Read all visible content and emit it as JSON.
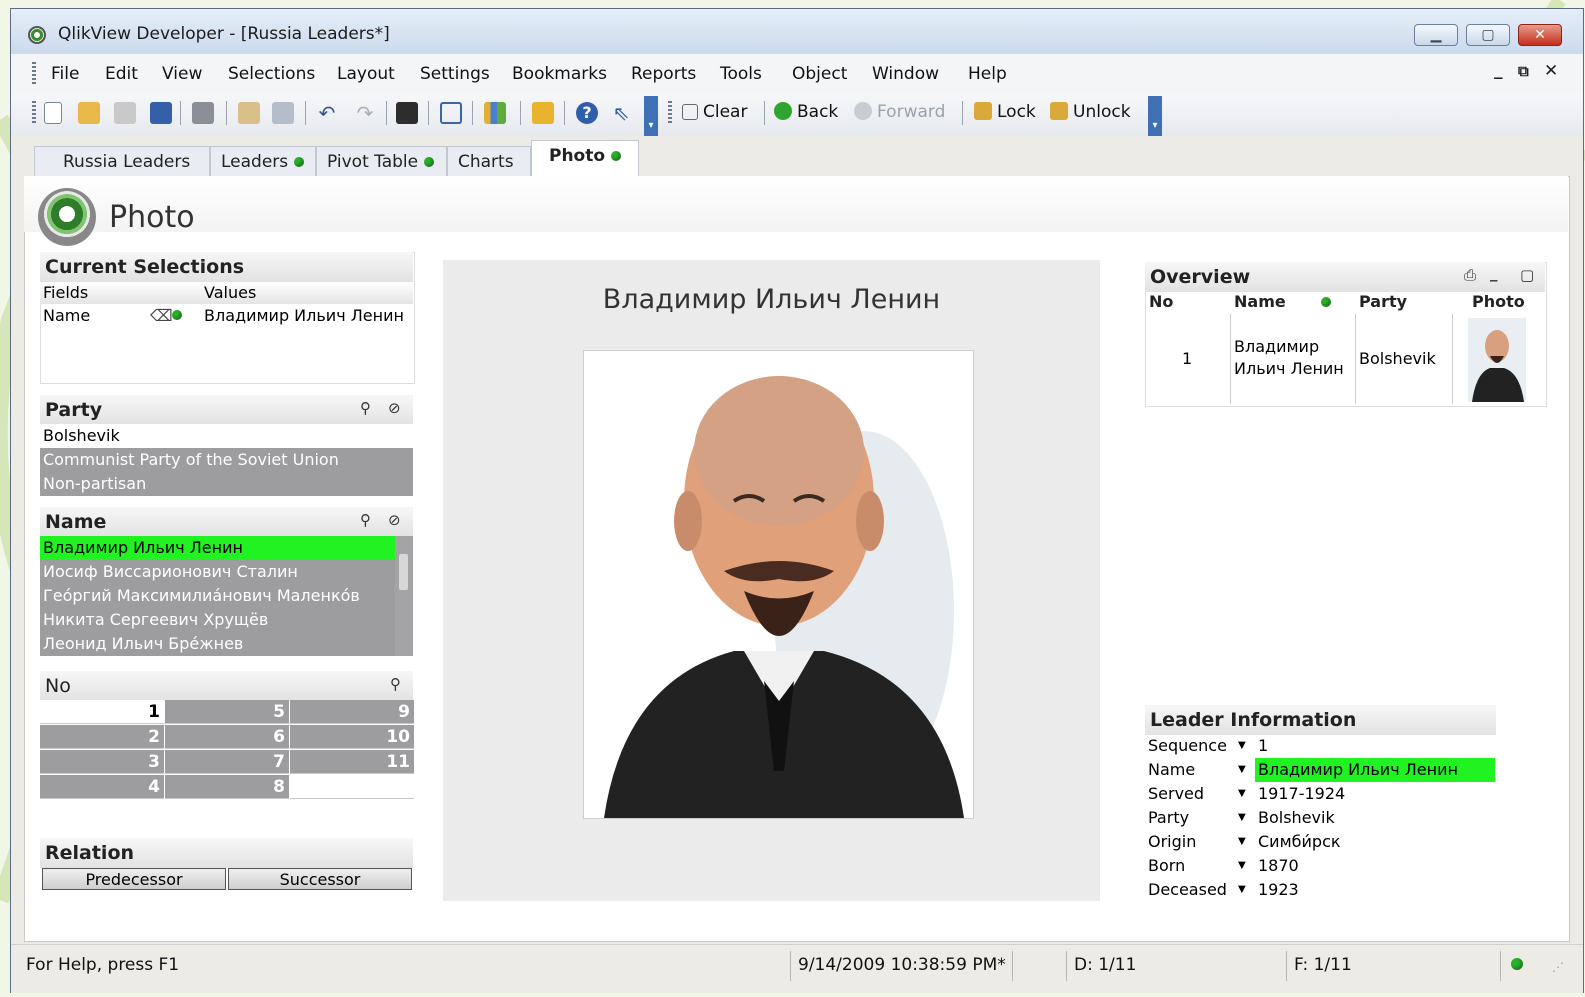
{
  "window": {
    "title": "QlikView Developer - [Russia Leaders*]",
    "min_icon": "minimize-icon",
    "max_icon": "maximize-icon",
    "close_icon": "close-icon"
  },
  "menu": [
    "File",
    "Edit",
    "View",
    "Selections",
    "Layout",
    "Settings",
    "Bookmarks",
    "Reports",
    "Tools",
    "Object",
    "Window",
    "Help"
  ],
  "mdi_controls": [
    "_",
    "⧉",
    "✕"
  ],
  "toolbar": {
    "clear_label": "Clear",
    "back_label": "Back",
    "forward_label": "Forward",
    "lock_label": "Lock",
    "unlock_label": "Unlock"
  },
  "tabs": [
    {
      "label": "Russia Leaders",
      "dot": false
    },
    {
      "label": "Leaders",
      "dot": true
    },
    {
      "label": "Pivot Table",
      "dot": true
    },
    {
      "label": "Charts",
      "dot": true
    },
    {
      "label": "Photo",
      "dot": true,
      "active": true
    }
  ],
  "sheet_title": "Photo",
  "current_selections": {
    "title": "Current Selections",
    "col_fields": "Fields",
    "col_values": "Values",
    "field": "Name",
    "value": "Владимир Ильич Ленин"
  },
  "party": {
    "title": "Party",
    "items": [
      "Bolshevik",
      "Communist Party of the Soviet Union",
      "Non-partisan"
    ]
  },
  "name_list": {
    "title": "Name",
    "items": [
      "Владимир Ильич Ленин",
      "Иосиф Виссарионович Сталин",
      "Гео́ргий Максимилиа́нович Маленко́в",
      "Никита Сергеевич Хрущёв",
      "Леонид Ильич Бре́жнев"
    ]
  },
  "no_list": {
    "title": "No",
    "col1": [
      "1",
      "2",
      "3",
      "4"
    ],
    "col2": [
      "5",
      "6",
      "7",
      "8"
    ],
    "col3": [
      "9",
      "10",
      "11",
      ""
    ]
  },
  "relation": {
    "title": "Relation",
    "predecessor": "Predecessor",
    "successor": "Successor"
  },
  "photo_panel": {
    "leader_name": "Владимир Ильич Ленин"
  },
  "overview": {
    "title": "Overview",
    "headers": [
      "No",
      "Name",
      "Party",
      "Photo"
    ],
    "row": {
      "no": "1",
      "name_line1": "Владимир",
      "name_line2": "Ильич Ленин",
      "party": "Bolshevik"
    }
  },
  "leader_info": {
    "title": "Leader Information",
    "rows": [
      {
        "label": "Sequence",
        "value": "1"
      },
      {
        "label": "Name",
        "value": "Владимир Ильич Ленин"
      },
      {
        "label": "Served",
        "value": "1917-1924"
      },
      {
        "label": "Party",
        "value": "Bolshevik"
      },
      {
        "label": "Origin",
        "value": "Симби́рск"
      },
      {
        "label": "Born",
        "value": "1870"
      },
      {
        "label": "Deceased",
        "value": "1923"
      }
    ]
  },
  "status": {
    "help": "For Help, press F1",
    "datetime": "9/14/2009 10:38:59 PM*",
    "d": "D: 1/11",
    "f": "F: 1/11"
  },
  "colors": {
    "selected": "#21f221",
    "excluded": "#9d9d9f",
    "status_green": "#29b12b"
  }
}
